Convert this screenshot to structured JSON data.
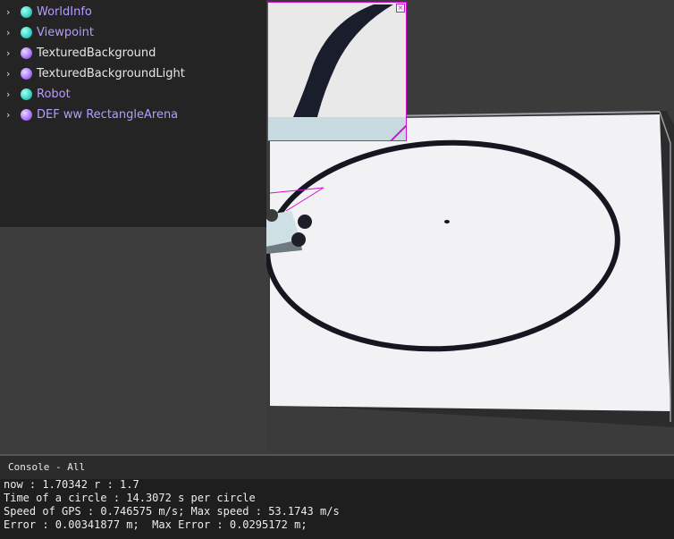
{
  "scene_tree": {
    "items": [
      {
        "label": "WorldInfo",
        "color": "#b59cff",
        "ball": "#3fd8c8"
      },
      {
        "label": "Viewpoint",
        "color": "#b59cff",
        "ball": "#3fd8c8"
      },
      {
        "label": "TexturedBackground",
        "color": "#e6e6e6",
        "ball": "#b07cff"
      },
      {
        "label": "TexturedBackgroundLight",
        "color": "#e6e6e6",
        "ball": "#b07cff"
      },
      {
        "label": "Robot",
        "color": "#b59cff",
        "ball": "#3fd8c8"
      },
      {
        "label": "DEF ww RectangleArena",
        "color": "#b59cff",
        "ball": "#b07cff"
      }
    ]
  },
  "camera_overlay": {
    "close_icon": "close-icon",
    "accent": "#d010d0"
  },
  "console": {
    "title": "Console - All",
    "lines": [
      "now : 1.70342 r : 1.7",
      "Time of a circle : 14.3072 s per circle",
      "Speed of GPS : 0.746575 m/s; Max speed : 53.1743 m/s",
      "Error : 0.00341877 m;  Max Error : 0.0295172 m;"
    ]
  }
}
